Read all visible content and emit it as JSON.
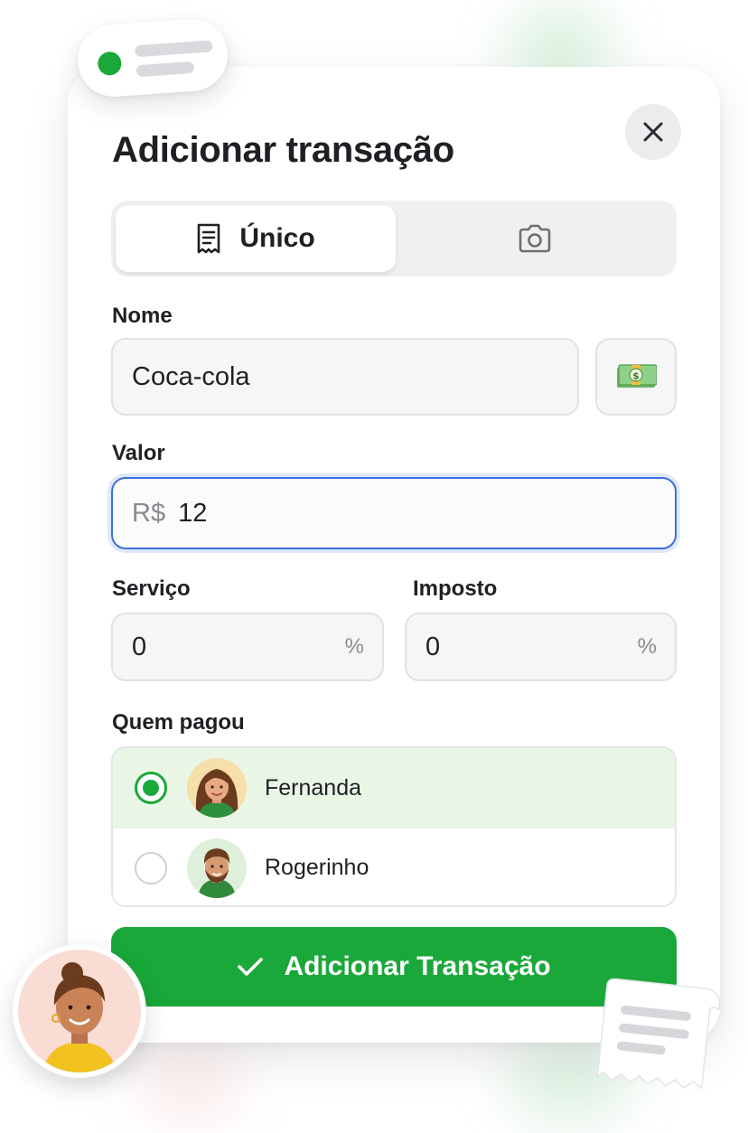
{
  "modal": {
    "title": "Adicionar transação",
    "close_icon": "close-icon"
  },
  "tabs": [
    {
      "label": "Único",
      "icon": "receipt-icon",
      "active": true
    },
    {
      "label": "",
      "icon": "camera-icon",
      "active": false
    }
  ],
  "form": {
    "name_label": "Nome",
    "name_value": "Coca-cola",
    "name_emoji_icon": "money-bill-icon",
    "value_label": "Valor",
    "value_prefix": "R$",
    "value_amount": "12",
    "service_label": "Serviço",
    "service_value": "0",
    "service_suffix": "%",
    "tax_label": "Imposto",
    "tax_value": "0",
    "tax_suffix": "%"
  },
  "payers": {
    "label": "Quem pagou",
    "options": [
      {
        "name": "Fernanda",
        "selected": true,
        "icon": "woman-avatar"
      },
      {
        "name": "Rogerinho",
        "selected": false,
        "icon": "man-avatar"
      }
    ]
  },
  "submit": {
    "label": "Adicionar Transação",
    "icon": "check-icon"
  },
  "colors": {
    "accent_green": "#1aa83a",
    "focus_blue": "#3b6fe0",
    "selected_row": "#e9f6e6"
  }
}
